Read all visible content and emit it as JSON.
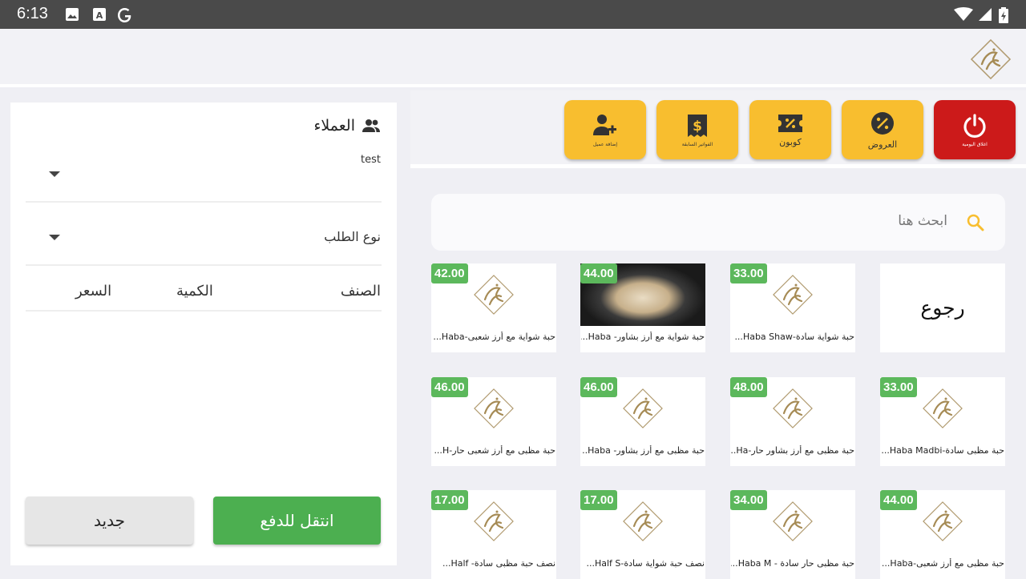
{
  "status_bar": {
    "time": "6:13"
  },
  "customers": {
    "title": "العملاء",
    "selected": "test",
    "order_type": "نوع الطلب"
  },
  "order_table": {
    "columns": [
      "الصنف",
      "الكمية",
      "السعر"
    ]
  },
  "buttons": {
    "new": "جديد",
    "pay": "انتقل للدفع"
  },
  "actions": [
    {
      "label": "اغلاق اليومية",
      "icon": "power-icon"
    },
    {
      "label": "العروض",
      "icon": "discount-badge-icon"
    },
    {
      "label": "كوبون",
      "icon": "coupon-icon"
    },
    {
      "label": "الفواتير السابقة",
      "icon": "receipt-icon"
    },
    {
      "label": "إضافة عميل",
      "icon": "add-user-icon"
    }
  ],
  "search": {
    "placeholder": "ابحث هنا"
  },
  "products": {
    "back_label": "رجوع",
    "items": [
      {
        "price": "33.00",
        "name": "حبة شواية سادة-Haba Shaw..."
      },
      {
        "price": "44.00",
        "name": "حبة شواية مع أرز بشاور- Haba..."
      },
      {
        "price": "42.00",
        "name": "حبة شواية مع أرز شعبى-Haba..."
      },
      {
        "price": "33.00",
        "name": "حبة مظبى سادة-Haba Madbi..."
      },
      {
        "price": "48.00",
        "name": "حبة مظبى مع أرز بشاور حار-Ha..."
      },
      {
        "price": "46.00",
        "name": "حبة مظبى مع أرز بشاور- Haba..."
      },
      {
        "price": "46.00",
        "name": "حبة مظبى مع أرز شعبى حار-H..."
      },
      {
        "price": "44.00",
        "name": "حبة مظبى مع أرز شعبى-Haba..."
      },
      {
        "price": "34.00",
        "name": "حبة مظبى حار سادة - Haba M..."
      },
      {
        "price": "17.00",
        "name": "نصف حبة شواية سادة-Half S..."
      },
      {
        "price": "17.00",
        "name": "نصف حبة مظبى سادة- Half..."
      }
    ]
  }
}
